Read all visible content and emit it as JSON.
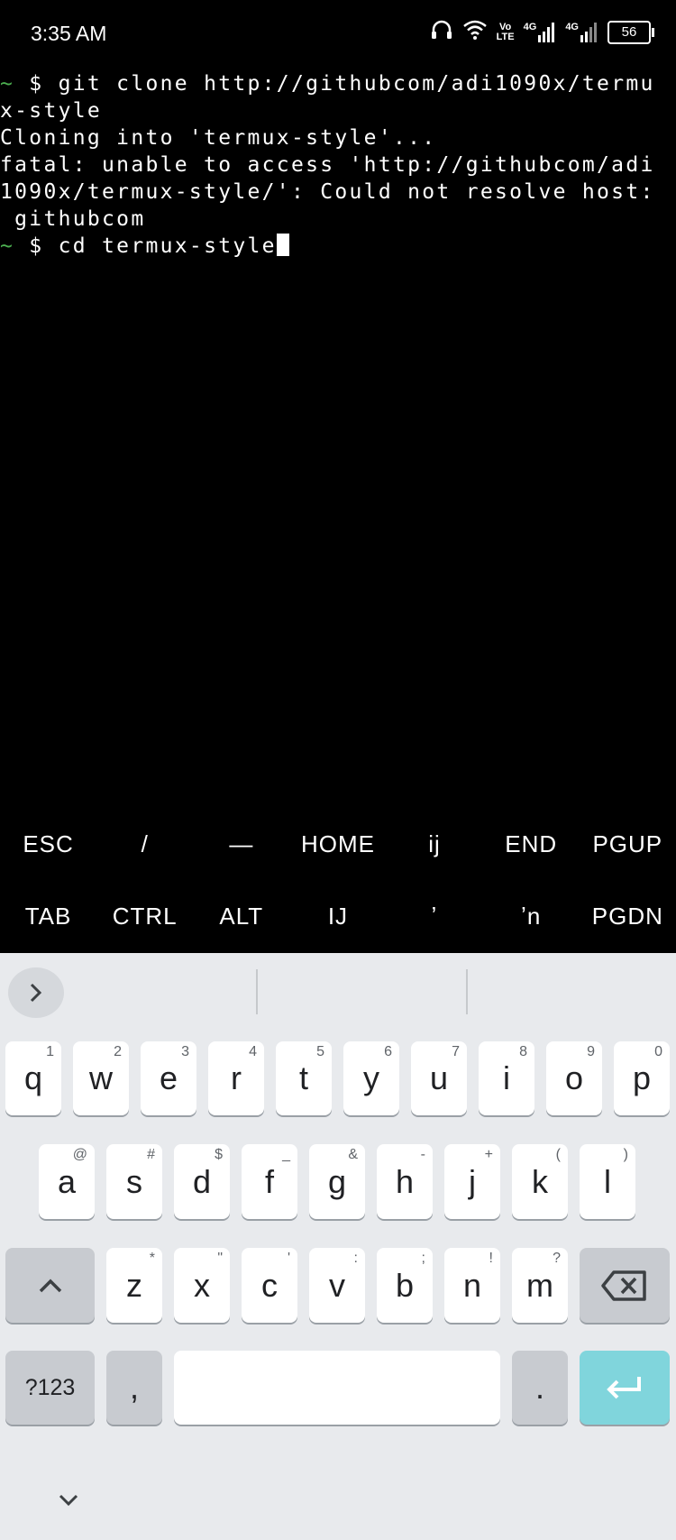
{
  "status": {
    "time": "3:35 AM",
    "volte_top": "Vo",
    "volte_bottom": "LTE",
    "net1": "4G",
    "net2": "4G",
    "battery": "56"
  },
  "terminal": {
    "lines": [
      {
        "prompt": "~",
        "text": " $ git clone http://githubcom/adi1090x/termu"
      },
      {
        "prompt": "",
        "text": "x-style"
      },
      {
        "prompt": "",
        "text": "Cloning into 'termux-style'..."
      },
      {
        "prompt": "",
        "text": "fatal: unable to access 'http://githubcom/adi"
      },
      {
        "prompt": "",
        "text": "1090x/termux-style/': Could not resolve host:"
      },
      {
        "prompt": "",
        "text": " githubcom"
      },
      {
        "prompt": "~",
        "text": " $ cd termux-style"
      }
    ]
  },
  "extra_keys": {
    "row1": [
      "ESC",
      "/",
      "—",
      "HOME",
      "ij",
      "END",
      "PGUP"
    ],
    "row2": [
      "TAB",
      "CTRL",
      "ALT",
      "IJ",
      "ʼ",
      "ʼn",
      "PGDN"
    ]
  },
  "keyboard": {
    "row1": [
      {
        "k": "q",
        "h": "1"
      },
      {
        "k": "w",
        "h": "2"
      },
      {
        "k": "e",
        "h": "3"
      },
      {
        "k": "r",
        "h": "4"
      },
      {
        "k": "t",
        "h": "5"
      },
      {
        "k": "y",
        "h": "6"
      },
      {
        "k": "u",
        "h": "7"
      },
      {
        "k": "i",
        "h": "8"
      },
      {
        "k": "o",
        "h": "9"
      },
      {
        "k": "p",
        "h": "0"
      }
    ],
    "row2": [
      {
        "k": "a",
        "h": "@"
      },
      {
        "k": "s",
        "h": "#"
      },
      {
        "k": "d",
        "h": "$"
      },
      {
        "k": "f",
        "h": "_"
      },
      {
        "k": "g",
        "h": "&"
      },
      {
        "k": "h",
        "h": "-"
      },
      {
        "k": "j",
        "h": "+"
      },
      {
        "k": "k",
        "h": "("
      },
      {
        "k": "l",
        "h": ")"
      }
    ],
    "row3": [
      {
        "k": "z",
        "h": "*"
      },
      {
        "k": "x",
        "h": "\""
      },
      {
        "k": "c",
        "h": "'"
      },
      {
        "k": "v",
        "h": ":"
      },
      {
        "k": "b",
        "h": ";"
      },
      {
        "k": "n",
        "h": "!"
      },
      {
        "k": "m",
        "h": "?"
      }
    ],
    "symbols_label": "?123",
    "comma": ",",
    "period": "."
  }
}
